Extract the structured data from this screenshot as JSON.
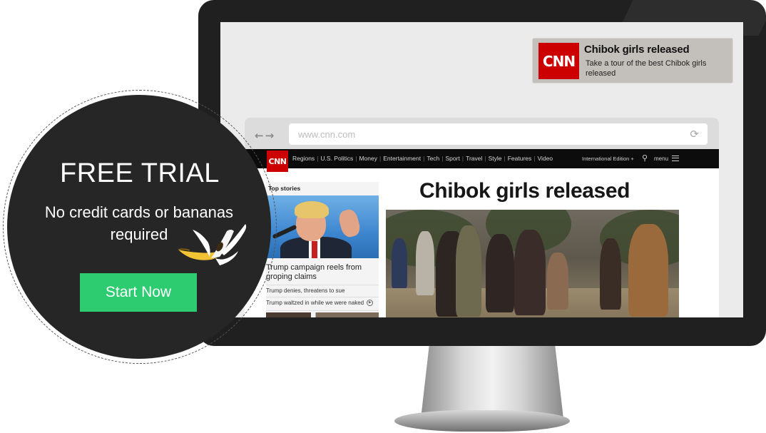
{
  "notification": {
    "logo_text": "CNN",
    "title": "Chibok girls released",
    "body": "Take a tour of the best Chibok girls released"
  },
  "browser": {
    "back_glyph": "←",
    "forward_glyph": "→",
    "url": "www.cnn.com",
    "reload_glyph": "⟳"
  },
  "cnn": {
    "logo_text": "CNN",
    "nav_items": [
      "Regions",
      "U.S. Politics",
      "Money",
      "Entertainment",
      "Tech",
      "Sport",
      "Travel",
      "Style",
      "Features",
      "Video"
    ],
    "edition": "International Edition +",
    "search_glyph": "⚲",
    "menu_label": "menu",
    "top_stories_heading": "Top stories",
    "lead_headline": "Trump campaign reels from groping claims",
    "links": [
      "Trump denies, threatens to sue",
      "Trump waltzed in while we were naked"
    ],
    "main_headline": "Chibok girls released"
  },
  "promo": {
    "title": "FREE TRIAL",
    "subtitle": "No credit cards or bananas required",
    "cta": "Start Now"
  },
  "colors": {
    "cnn_red": "#cc0000",
    "cta_green": "#2ecc71",
    "badge_dark": "#262626",
    "monitor_bezel": "#202020"
  },
  "icons": [
    "back-arrow-icon",
    "forward-arrow-icon",
    "reload-icon",
    "search-icon",
    "menu-icon",
    "play-icon",
    "banana-icon"
  ]
}
